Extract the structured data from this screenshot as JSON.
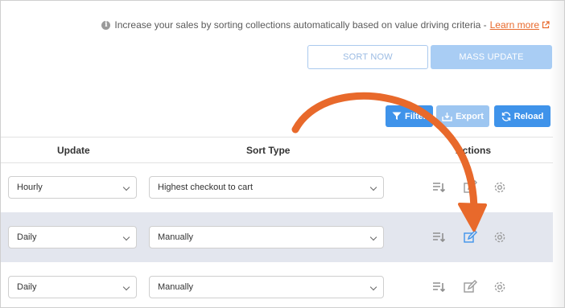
{
  "banner": {
    "info_text": "Increase your sales by sorting collections automatically based on value driving criteria -",
    "learn_more": "Learn more"
  },
  "actions_bar": {
    "sort_now": "SORT NOW",
    "mass_update": "MASS UPDATE"
  },
  "toolbar": {
    "filter": "Filter",
    "export": "Export",
    "reload": "Reload"
  },
  "table": {
    "headers": {
      "update": "Update",
      "sort_type": "Sort Type",
      "actions": "Actions"
    },
    "rows": [
      {
        "update": "Hourly",
        "sort_type": "Highest checkout to cart"
      },
      {
        "update": "Daily",
        "sort_type": "Manually"
      },
      {
        "update": "Daily",
        "sort_type": "Manually"
      }
    ]
  },
  "colors": {
    "primary": "#3f93ea",
    "primary_light": "#a9cdf4",
    "accent_orange": "#e8692b",
    "highlight_row": "#e3e6ee",
    "icon_gray": "#9a9a9a"
  },
  "icons": [
    "info-icon",
    "external-link-icon",
    "filter-icon",
    "export-icon",
    "reload-icon",
    "sort-icon",
    "edit-icon",
    "gear-icon",
    "chevron-down-icon",
    "curved-arrow-annotation"
  ]
}
